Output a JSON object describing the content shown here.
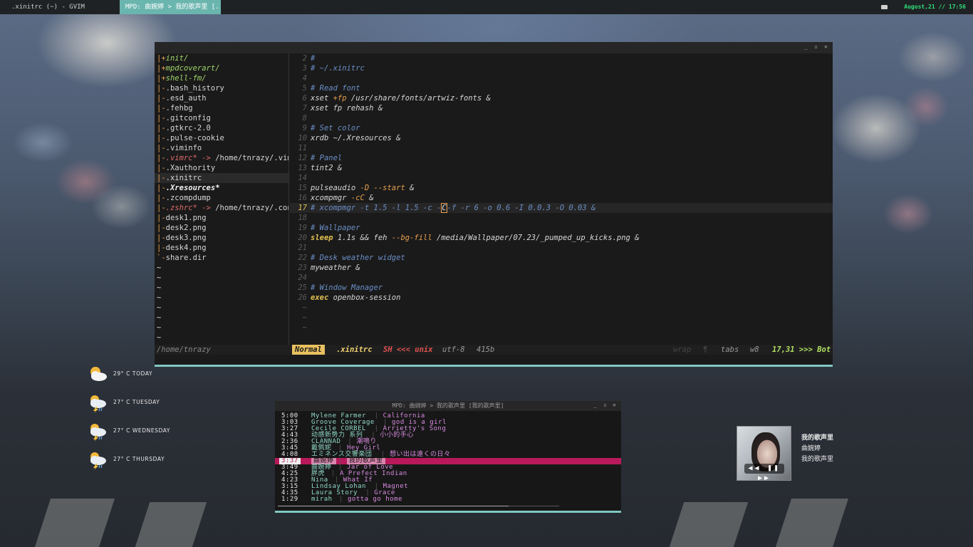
{
  "panel": {
    "task_gvim": ".xinitrc (~) - GVIM",
    "task_mpd": "MPD: 曲婉婷 > 我的歌声里 [...",
    "clock": "August,21 // 17:56"
  },
  "gvim": {
    "tree": [
      {
        "bar": "|+",
        "name": "init/",
        "kind": "dir"
      },
      {
        "bar": "|+",
        "name": "mpdcoverart/",
        "kind": "dir"
      },
      {
        "bar": "|+",
        "name": "shell-fm/",
        "kind": "dir"
      },
      {
        "bar": "|-",
        "name": ".bash_history",
        "kind": "file"
      },
      {
        "bar": "|-",
        "name": ".esd_auth",
        "kind": "file"
      },
      {
        "bar": "|-",
        "name": ".fehbg",
        "kind": "file"
      },
      {
        "bar": "|-",
        "name": ".gitconfig",
        "kind": "file"
      },
      {
        "bar": "|-",
        "name": ".gtkrc-2.0",
        "kind": "file"
      },
      {
        "bar": "|-",
        "name": ".pulse-cookie",
        "kind": "file"
      },
      {
        "bar": "|-",
        "name": ".viminfo",
        "kind": "file"
      },
      {
        "bar": "|-",
        "name": ".vimrc* ->",
        "target": " /home/tnrazy/.vim/",
        "kind": "link"
      },
      {
        "bar": "|-",
        "name": ".Xauthority",
        "kind": "file"
      },
      {
        "bar": "|-",
        "name": ".xinitrc",
        "kind": "selected"
      },
      {
        "bar": "|-",
        "name": ".Xresources*",
        "kind": "bold"
      },
      {
        "bar": "|-",
        "name": ".zcompdump",
        "kind": "file"
      },
      {
        "bar": "|-",
        "name": ".zshrc* ->",
        "target": " /home/tnrazy/.conf",
        "kind": "link"
      },
      {
        "bar": "|-",
        "name": "desk1.png",
        "kind": "file"
      },
      {
        "bar": "|-",
        "name": "desk2.png",
        "kind": "file"
      },
      {
        "bar": "|-",
        "name": "desk3.png",
        "kind": "file"
      },
      {
        "bar": "|-",
        "name": "desk4.png",
        "kind": "file"
      },
      {
        "bar": "`-",
        "name": "share.dir",
        "kind": "file"
      }
    ],
    "code": [
      {
        "n": "2",
        "parts": [
          [
            "cmt",
            "#"
          ]
        ]
      },
      {
        "n": "3",
        "parts": [
          [
            "cmt",
            "# ~/.xinitrc"
          ]
        ]
      },
      {
        "n": "4",
        "parts": []
      },
      {
        "n": "5",
        "parts": [
          [
            "cmt",
            "# Read font"
          ]
        ]
      },
      {
        "n": "6",
        "parts": [
          [
            "",
            "xset "
          ],
          [
            "flag",
            "+fp"
          ],
          [
            "",
            " /usr/share/fonts/artwiz-fonts &"
          ]
        ]
      },
      {
        "n": "7",
        "parts": [
          [
            "",
            "xset fp rehash &"
          ]
        ]
      },
      {
        "n": "8",
        "parts": []
      },
      {
        "n": "9",
        "parts": [
          [
            "cmt",
            "# Set color"
          ]
        ]
      },
      {
        "n": "10",
        "parts": [
          [
            "",
            "xrdb ~/.Xresources &"
          ]
        ]
      },
      {
        "n": "11",
        "parts": []
      },
      {
        "n": "12",
        "parts": [
          [
            "cmt",
            "# Panel"
          ]
        ]
      },
      {
        "n": "13",
        "parts": [
          [
            "",
            "tint2 &"
          ]
        ]
      },
      {
        "n": "14",
        "parts": []
      },
      {
        "n": "15",
        "parts": [
          [
            "",
            "pulseaudio "
          ],
          [
            "flag",
            "-D --start"
          ],
          [
            "",
            " &"
          ]
        ]
      },
      {
        "n": "16",
        "parts": [
          [
            "",
            "xcompmgr "
          ],
          [
            "flag",
            "-cC"
          ],
          [
            "",
            " &"
          ]
        ]
      },
      {
        "n": "17",
        "parts": [
          [
            "cmt",
            "# xcompmgr -t 1.5 -l 1.5 -c -"
          ],
          [
            "cursor",
            "C"
          ],
          [
            "cmt",
            "-f -r 6 -o 0.6 -I 0.0.3 -O 0.03 &"
          ]
        ],
        "current": true
      },
      {
        "n": "18",
        "parts": []
      },
      {
        "n": "19",
        "parts": [
          [
            "cmt",
            "# Wallpaper"
          ]
        ]
      },
      {
        "n": "20",
        "parts": [
          [
            "kw",
            "sleep"
          ],
          [
            "",
            " 1.1s && feh "
          ],
          [
            "flag",
            "--bg-fill"
          ],
          [
            "",
            " /media/Wallpaper/07.23/_pumped_up_kicks.png &"
          ]
        ]
      },
      {
        "n": "21",
        "parts": []
      },
      {
        "n": "22",
        "parts": [
          [
            "cmt",
            "# Desk weather widget"
          ]
        ]
      },
      {
        "n": "23",
        "parts": [
          [
            "",
            "myweather &"
          ]
        ]
      },
      {
        "n": "24",
        "parts": []
      },
      {
        "n": "25",
        "parts": [
          [
            "cmt",
            "# Window Manager"
          ]
        ]
      },
      {
        "n": "26",
        "parts": [
          [
            "kw",
            "exec"
          ],
          [
            "",
            " openbox-session"
          ]
        ]
      }
    ],
    "status": {
      "path": "/home/tnrazy",
      "mode": "Normal",
      "file": ".xinitrc",
      "sh": "SH <<< unix",
      "enc": "utf-8",
      "size": "415b",
      "wrap": "wrap",
      "pil": "¶",
      "tabs": "tabs",
      "w8": "w8",
      "pos": "17,31 >>> Bot"
    }
  },
  "weather": [
    {
      "label": "29° C TODAY",
      "icon": "cloud-sun-icon"
    },
    {
      "label": "27° C TUESDAY",
      "icon": "thunderstorm-icon"
    },
    {
      "label": "27° C WEDNESDAY",
      "icon": "thunderstorm-icon"
    },
    {
      "label": "27° C THURSDAY",
      "icon": "thunderstorm-icon"
    }
  ],
  "mpd": {
    "title": "MPD: 曲婉婷 > 我的歌声里 [我的歌声里]",
    "playlist": [
      {
        "time": "5:00",
        "artist": "Mylene Farmer",
        "title": "California"
      },
      {
        "time": "3:03",
        "artist": "Groove Coverage",
        "title": "god is a girl"
      },
      {
        "time": "3:27",
        "artist": "Cecile CORBEL",
        "title": "Arrietty's Song"
      },
      {
        "time": "4:43",
        "artist": "动感新势力 系列",
        "title": "小小的手心"
      },
      {
        "time": "2:36",
        "artist": "CLANNAD",
        "title": "潮鳴り"
      },
      {
        "time": "3:45",
        "artist": "戴佩妮",
        "title": "Hey Girl"
      },
      {
        "time": "4:08",
        "artist": "エミネンス交響楽団",
        "title": "想い出は遠くの日々"
      },
      {
        "time": "3:37",
        "artist": "曲婉婷",
        "title": "我的歌声里",
        "playing": true
      },
      {
        "time": "3:49",
        "artist": "曲婉婷",
        "title": "Jar of Love"
      },
      {
        "time": "4:25",
        "artist": "胖虎",
        "title": "A Prefect Indian"
      },
      {
        "time": "4:23",
        "artist": "Nina",
        "title": "What If"
      },
      {
        "time": "3:15",
        "artist": "Lindsay Lohan",
        "title": "Magnet"
      },
      {
        "time": "4:35",
        "artist": "Laura Story",
        "title": "Grace"
      },
      {
        "time": "1:29",
        "artist": "mirah",
        "title": "gotta go home"
      }
    ],
    "progress": 0.82
  },
  "nowplaying": {
    "title": "我的歌声里",
    "artist": "曲婉婷",
    "album": "我的歌声里",
    "controls": "◀◀ ❚❚ ▶▶"
  }
}
